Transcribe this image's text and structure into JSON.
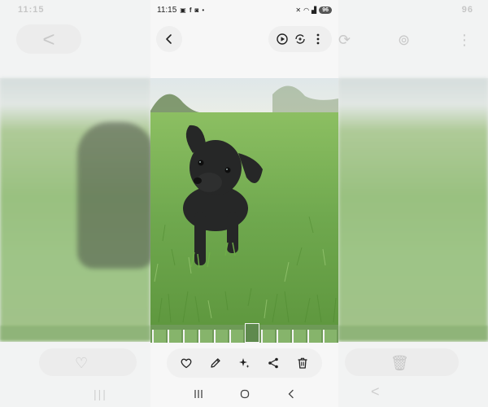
{
  "status_bar": {
    "time": "11:15",
    "battery": "96",
    "dot": "•"
  },
  "ghost_left": {
    "time": "11:15",
    "back_glyph": "<"
  },
  "ghost_right": {
    "battery": "96",
    "back_glyph": "<"
  },
  "icons": {
    "back": "back-arrow-icon",
    "slideshow": "play-circle-icon",
    "remaster": "rotate-sparkle-icon",
    "more": "more-vertical-icon",
    "favorite": "heart-icon",
    "edit": "pencil-icon",
    "effects": "sparkle-icon",
    "share": "share-icon",
    "delete": "trash-icon"
  },
  "colors": {
    "grass": "#7fb35d",
    "dog": "#2b2c2c",
    "chrome": "#f7f7f7",
    "icon": "#222222"
  },
  "filmstrip": {
    "count": 12,
    "active_index": 6
  }
}
